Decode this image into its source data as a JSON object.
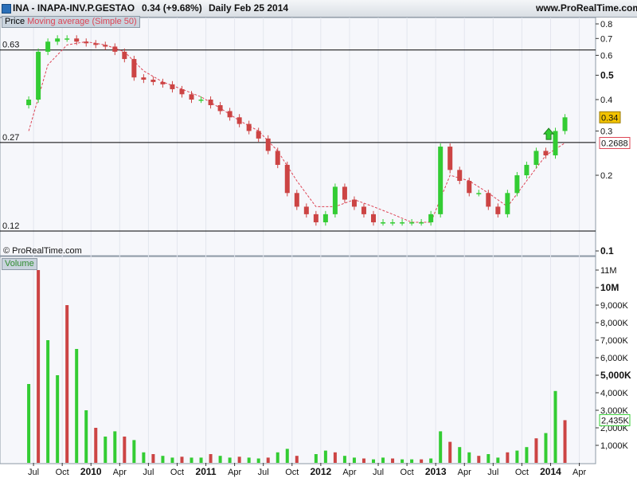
{
  "header": {
    "symbol": "INA - INAPA-INV.P.GESTAO",
    "quote": "0.34 (+9.68%)",
    "period": "Daily  Feb 25 2014",
    "site": "www.ProRealTime.com"
  },
  "price_panel": {
    "legend_price": "Price",
    "legend_ma": "Moving average (Simple 50)",
    "watermark": "© ProRealTime.com",
    "hline_labels": [
      "0.63",
      "0.27",
      "0.12"
    ],
    "last_price_label": "0.34",
    "ma_value_label": "0.2688"
  },
  "volume_panel": {
    "legend": "Volume",
    "last_volume_label": "2,435K"
  },
  "colors": {
    "up": "#33cc33",
    "down": "#cc4444",
    "ma": "#dd4455",
    "price_badge": "#f2c200"
  },
  "chart_data": [
    {
      "type": "candlestick",
      "title": "INA - INAPA-INV.P.GESTAO",
      "y_scale": "log",
      "ylim": [
        0.1,
        0.8
      ],
      "y_ticks": [
        "0.1",
        "0.2",
        "0.3",
        "0.4",
        "0.5",
        "0.6",
        "0.7",
        "0.8"
      ],
      "x_ticks": [
        "Jul",
        "Oct",
        "2010",
        "Apr",
        "Jul",
        "Oct",
        "2011",
        "Apr",
        "Jul",
        "Oct",
        "2012",
        "Apr",
        "Jul",
        "Oct",
        "2013",
        "Apr",
        "Jul",
        "Oct",
        "2014",
        "Apr"
      ],
      "horizontal_lines": [
        0.63,
        0.27,
        0.12
      ],
      "series": [
        {
          "name": "Price",
          "x": [
            "2009-06",
            "2009-07",
            "2009-08",
            "2009-09",
            "2009-10",
            "2009-11",
            "2009-12",
            "2010-01",
            "2010-02",
            "2010-03",
            "2010-04",
            "2010-05",
            "2010-06",
            "2010-07",
            "2010-08",
            "2010-09",
            "2010-10",
            "2010-11",
            "2010-12",
            "2011-01",
            "2011-02",
            "2011-03",
            "2011-04",
            "2011-05",
            "2011-06",
            "2011-07",
            "2011-08",
            "2011-09",
            "2011-10",
            "2011-11",
            "2011-12",
            "2012-01",
            "2012-02",
            "2012-03",
            "2012-04",
            "2012-05",
            "2012-06",
            "2012-07",
            "2012-08",
            "2012-09",
            "2012-10",
            "2012-11",
            "2012-12",
            "2013-01",
            "2013-02",
            "2013-03",
            "2013-04",
            "2013-05",
            "2013-06",
            "2013-07",
            "2013-08",
            "2013-09",
            "2013-10",
            "2013-11",
            "2013-12",
            "2014-01",
            "2014-02"
          ],
          "values": [
            0.4,
            0.62,
            0.68,
            0.7,
            0.7,
            0.68,
            0.67,
            0.66,
            0.65,
            0.62,
            0.58,
            0.49,
            0.48,
            0.47,
            0.46,
            0.44,
            0.42,
            0.4,
            0.4,
            0.38,
            0.36,
            0.34,
            0.32,
            0.3,
            0.28,
            0.25,
            0.22,
            0.17,
            0.15,
            0.14,
            0.13,
            0.14,
            0.18,
            0.16,
            0.15,
            0.14,
            0.13,
            0.13,
            0.13,
            0.13,
            0.13,
            0.13,
            0.14,
            0.26,
            0.21,
            0.19,
            0.17,
            0.17,
            0.15,
            0.14,
            0.17,
            0.2,
            0.22,
            0.25,
            0.24,
            0.3,
            0.34
          ]
        },
        {
          "name": "Moving average (Simple 50)",
          "x": [
            "2009-06",
            "2009-08",
            "2009-10",
            "2009-12",
            "2010-02",
            "2010-04",
            "2010-06",
            "2010-08",
            "2010-10",
            "2010-12",
            "2011-02",
            "2011-04",
            "2011-06",
            "2011-08",
            "2011-10",
            "2011-12",
            "2012-02",
            "2012-04",
            "2012-06",
            "2012-08",
            "2012-10",
            "2012-12",
            "2013-02",
            "2013-04",
            "2013-06",
            "2013-08",
            "2013-10",
            "2013-12",
            "2014-02"
          ],
          "values": [
            0.3,
            0.55,
            0.66,
            0.68,
            0.66,
            0.62,
            0.52,
            0.47,
            0.44,
            0.41,
            0.37,
            0.33,
            0.3,
            0.25,
            0.19,
            0.15,
            0.15,
            0.16,
            0.15,
            0.14,
            0.13,
            0.13,
            0.2,
            0.19,
            0.17,
            0.15,
            0.19,
            0.24,
            0.2688
          ]
        }
      ]
    },
    {
      "type": "bar",
      "title": "Volume",
      "y_ticks": [
        "1,000K",
        "2,000K",
        "3,000K",
        "4,000K",
        "5,000K",
        "6,000K",
        "7,000K",
        "8,000K",
        "9,000K",
        "10M",
        "11M"
      ],
      "ylim": [
        0,
        11500
      ],
      "y_unit": "K",
      "series": [
        {
          "name": "Volume",
          "x": [
            "2009-06",
            "2009-07",
            "2009-08",
            "2009-09",
            "2009-10",
            "2009-11",
            "2009-12",
            "2010-01",
            "2010-02",
            "2010-03",
            "2010-04",
            "2010-05",
            "2010-06",
            "2010-07",
            "2010-08",
            "2010-09",
            "2010-10",
            "2010-11",
            "2010-12",
            "2011-01",
            "2011-02",
            "2011-03",
            "2011-04",
            "2011-05",
            "2011-06",
            "2011-07",
            "2011-08",
            "2011-09",
            "2011-10",
            "2011-12",
            "2012-01",
            "2012-02",
            "2012-03",
            "2012-04",
            "2012-05",
            "2012-06",
            "2012-07",
            "2012-08",
            "2012-09",
            "2012-10",
            "2012-11",
            "2012-12",
            "2013-01",
            "2013-02",
            "2013-03",
            "2013-04",
            "2013-05",
            "2013-06",
            "2013-07",
            "2013-08",
            "2013-09",
            "2013-10",
            "2013-11",
            "2013-12",
            "2014-01",
            "2014-02"
          ],
          "values": [
            4500,
            11000,
            7000,
            5000,
            9000,
            6500,
            3000,
            2000,
            1500,
            1800,
            1500,
            1300,
            600,
            500,
            400,
            300,
            350,
            300,
            300,
            500,
            400,
            300,
            350,
            300,
            250,
            300,
            600,
            800,
            400,
            500,
            700,
            600,
            400,
            300,
            250,
            200,
            300,
            250,
            200,
            200,
            200,
            250,
            1800,
            1200,
            900,
            600,
            400,
            500,
            300,
            600,
            700,
            900,
            1400,
            1700,
            4100,
            2435
          ]
        }
      ]
    }
  ]
}
